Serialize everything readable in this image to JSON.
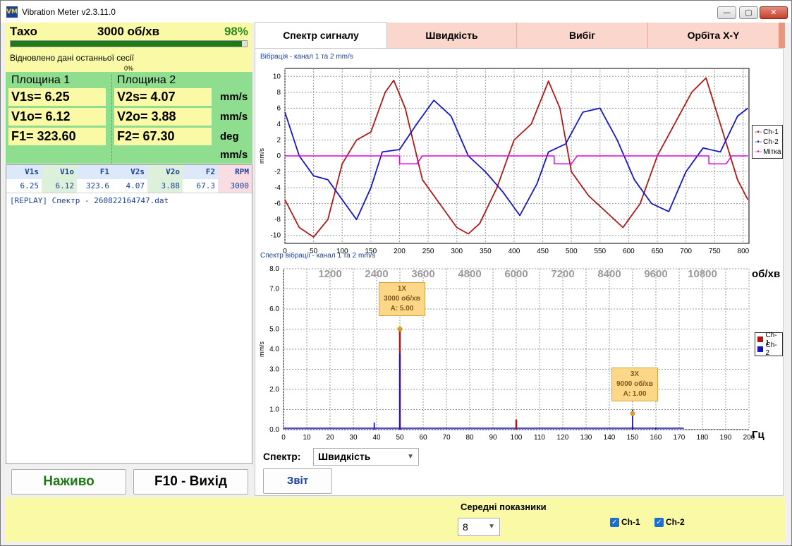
{
  "window": {
    "title": "Vibration Meter v2.3.11.0",
    "icon": "VM",
    "minimize": "—",
    "maximize": "▢",
    "close": "✕"
  },
  "tacho": {
    "label": "Тахо",
    "rpm": "3000 об/хв",
    "percent": "98%",
    "progress_fraction": 0.98,
    "message": "Відновлено дані останньої сесії",
    "zero_label": "0%"
  },
  "planes": {
    "plane1_title": "Площина 1",
    "plane2_title": "Площина 2",
    "v1s": "V1s= 6.25",
    "v1o": "V1o= 6.12",
    "f1": "F1= 323.60",
    "v2s": "V2s= 4.07",
    "v2o": "V2o= 3.88",
    "f2": "F2= 67.30",
    "units": [
      "mm/s",
      "mm/s",
      "deg",
      "mm/s"
    ]
  },
  "results_table": {
    "headers": [
      "V1s",
      "V1o",
      "F1",
      "V2s",
      "V2o",
      "F2",
      "RPM"
    ],
    "rows": [
      [
        "6.25",
        "6.12",
        "323.6",
        "4.07",
        "3.88",
        "67.3",
        "3000"
      ]
    ],
    "log": "[REPLAY] Спектр - 260822164747.dat"
  },
  "buttons": {
    "live": "Наживо",
    "exit": "F10 - Вихід",
    "report": "Звіт"
  },
  "tabs": [
    "Спектр сигналу",
    "Швидкість",
    "Вибіг",
    "Орбіта X-Y"
  ],
  "colors": {
    "ch1": "#b01818",
    "ch2": "#1515c8",
    "marker": "#e000e0",
    "accent_green": "#1e7a14",
    "tab_bg": "#fbd6cc"
  },
  "chart_data": [
    {
      "type": "line",
      "title": "Вібрація  - канал 1 та 2 mm/s",
      "ylabel": "mm/s",
      "xlim": [
        0,
        810
      ],
      "ylim": [
        -11,
        11
      ],
      "xticks": [
        0,
        50,
        100,
        150,
        200,
        250,
        300,
        350,
        400,
        450,
        500,
        550,
        600,
        650,
        700,
        750,
        800
      ],
      "yticks": [
        10,
        8,
        6,
        4,
        2,
        0,
        -2,
        -4,
        -6,
        -8,
        -10
      ],
      "grid": true,
      "legend_position": "right",
      "series": [
        {
          "name": "Ch-1",
          "color": "#b01818",
          "x": [
            0,
            25,
            50,
            75,
            100,
            125,
            150,
            175,
            190,
            210,
            240,
            270,
            300,
            320,
            340,
            370,
            400,
            430,
            460,
            480,
            500,
            530,
            560,
            590,
            620,
            650,
            680,
            710,
            735,
            760,
            790,
            808
          ],
          "y": [
            -5.5,
            -9,
            -10.2,
            -8,
            -1,
            2,
            3,
            8,
            9.5,
            6,
            -3,
            -6,
            -9,
            -9.8,
            -8.5,
            -4,
            2,
            4,
            9.4,
            6,
            -2,
            -5,
            -7,
            -9,
            -6,
            0,
            4,
            8,
            9.8,
            4,
            -3,
            -5.5
          ]
        },
        {
          "name": "Ch-2",
          "color": "#1515c8",
          "x": [
            0,
            25,
            50,
            75,
            100,
            125,
            150,
            170,
            200,
            230,
            260,
            290,
            320,
            350,
            380,
            410,
            440,
            460,
            490,
            520,
            550,
            580,
            610,
            640,
            670,
            700,
            730,
            760,
            790,
            808
          ],
          "y": [
            5.5,
            0,
            -2.5,
            -3,
            -5.5,
            -8,
            -4,
            0.5,
            0.8,
            4,
            7,
            5,
            0,
            -2,
            -4.5,
            -7.5,
            -3.5,
            0.5,
            1.5,
            5.5,
            6,
            2,
            -3,
            -6,
            -7,
            -2,
            1,
            0.5,
            5,
            6
          ]
        },
        {
          "name": "Мітка",
          "color": "#e000e0",
          "x": [
            0,
            200,
            200,
            230,
            240,
            470,
            470,
            500,
            510,
            740,
            740,
            770,
            780,
            808
          ],
          "y": [
            0,
            0,
            -1,
            -1,
            0,
            0,
            -1,
            -1,
            0,
            0,
            -1,
            -1,
            0,
            0
          ]
        }
      ]
    },
    {
      "type": "bar",
      "title": "Спектр вібрації  - канал 1 та 2 mm/s",
      "ylabel": "mm/s",
      "xlabel": "Гц",
      "top_axis_label": "об/хв",
      "xlim": [
        0,
        200
      ],
      "ylim": [
        0,
        8
      ],
      "xticks": [
        0,
        10,
        20,
        30,
        40,
        50,
        60,
        70,
        80,
        90,
        100,
        110,
        120,
        130,
        140,
        150,
        160,
        170,
        180,
        190,
        200
      ],
      "yticks": [
        "8.0",
        "7.0",
        "6.0",
        "5.0",
        "4.0",
        "3.0",
        "2.0",
        "1.0",
        "0.0"
      ],
      "rpm_ticks": [
        "1200",
        "2400",
        "3600",
        "4800",
        "6000",
        "7200",
        "8400",
        "9600",
        "10800"
      ],
      "rpm_tick_hz": [
        20,
        40,
        60,
        80,
        100,
        120,
        140,
        160,
        180
      ],
      "grid": true,
      "legend_position": "right",
      "series": [
        {
          "name": "Ch-1",
          "color": "#b01818",
          "x": [
            50,
            100,
            150
          ],
          "values": [
            5.0,
            0.5,
            0.15
          ]
        },
        {
          "name": "Ch-2",
          "color": "#1515c8",
          "x": [
            39,
            50,
            150,
            160
          ],
          "values": [
            0.35,
            3.8,
            1.0,
            0.1
          ]
        }
      ],
      "annotations": [
        {
          "line1": "1X",
          "line2": "3000 об/хв",
          "line3": "A: 5.00",
          "x": 50,
          "y": 5.0
        },
        {
          "line1": "3X",
          "line2": "9000 об/хв",
          "line3": "A: 1.00",
          "x": 150,
          "y": 0.8
        }
      ]
    }
  ],
  "bottom": {
    "spectrum_label": "Спектр:",
    "spectrum_value": "Швидкість",
    "averaging_label": "Середні показники",
    "averaging_value": "8",
    "ch1": "Ch-1",
    "ch2": "Ch-2",
    "check": "✓"
  }
}
